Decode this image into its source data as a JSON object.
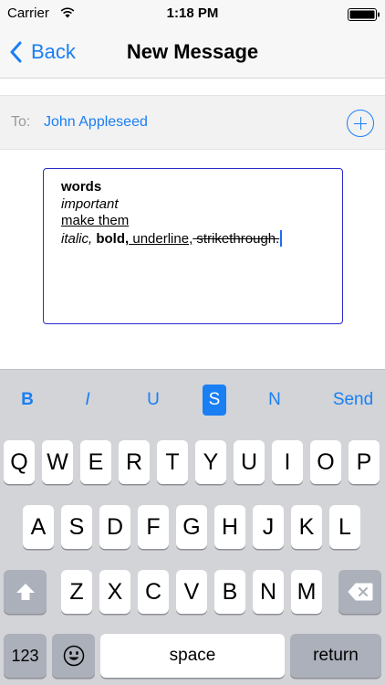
{
  "status_bar": {
    "carrier": "Carrier",
    "time": "1:18 PM"
  },
  "nav": {
    "back_label": "Back",
    "title": "New Message"
  },
  "to_row": {
    "label": "To:",
    "recipient": "John Appleseed"
  },
  "editor": {
    "line1_bold": "words",
    "line2_italic": "important",
    "line3_underline": "make them",
    "line4": {
      "italic": "italic,",
      "bold": "bold,",
      "underline": " underline,",
      "strike": " strikethrough."
    }
  },
  "format_toolbar": {
    "bold": "B",
    "italic": "I",
    "underline": "U",
    "strike": "S",
    "normal": "N",
    "send": "Send",
    "active": "S",
    "accent_color": "#1a7ff3"
  },
  "keyboard": {
    "row1": [
      "Q",
      "W",
      "E",
      "R",
      "T",
      "Y",
      "U",
      "I",
      "O",
      "P"
    ],
    "row2": [
      "A",
      "S",
      "D",
      "F",
      "G",
      "H",
      "J",
      "K",
      "L"
    ],
    "row3": [
      "Z",
      "X",
      "C",
      "V",
      "B",
      "N",
      "M"
    ],
    "numbers": "123",
    "space": "space",
    "return": "return",
    "icons": [
      "shift-icon",
      "delete-icon",
      "emoji-icon"
    ]
  }
}
